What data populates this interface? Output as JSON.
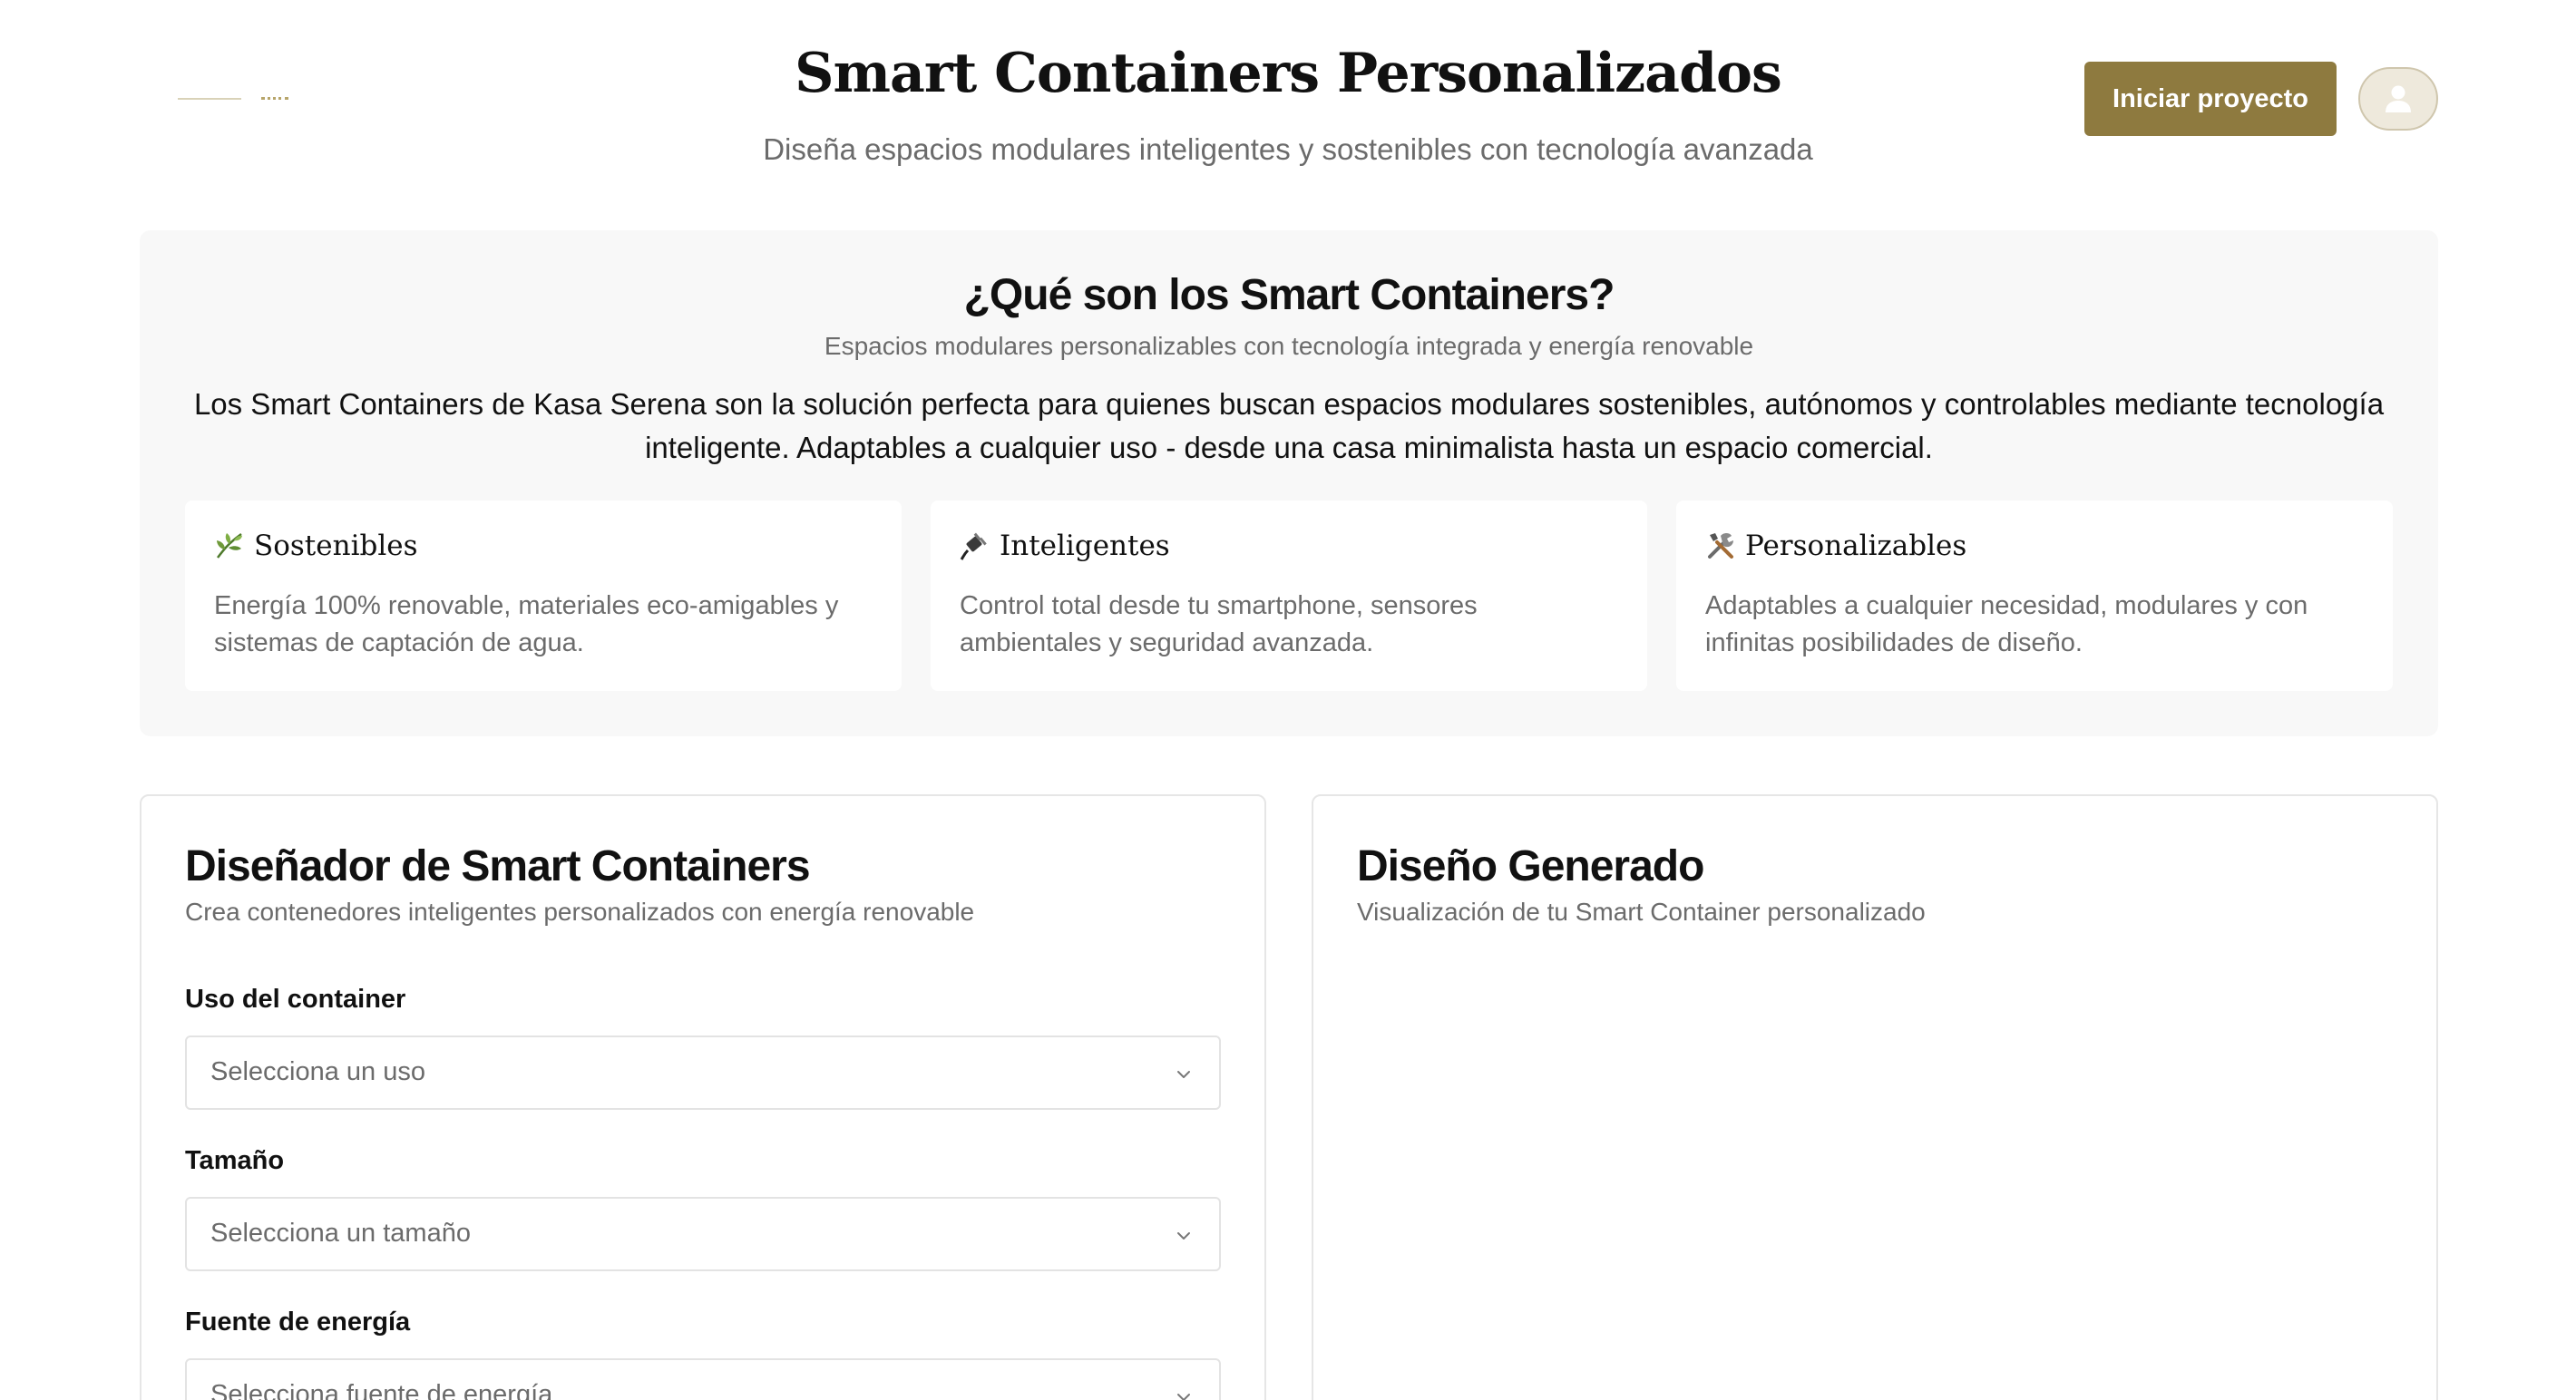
{
  "header": {
    "title": "Smart Containers Personalizados",
    "subtitle": "Diseña espacios modulares inteligentes y sostenibles con tecnología avanzada",
    "start_button": "Iniciar proyecto"
  },
  "intro": {
    "title": "¿Qué son los Smart Containers?",
    "subtitle": "Espacios modulares personalizables con tecnología integrada y energía renovable",
    "body": "Los Smart Containers de Kasa Serena son la solución perfecta para quienes buscan espacios modulares sostenibles, autónomos y controlables mediante tecnología inteligente. Adaptables a cualquier uso - desde una casa minimalista hasta un espacio comercial.",
    "features": [
      {
        "icon": "herb-icon",
        "title": "Sostenibles",
        "text": "Energía 100% renovable, materiales eco-amigables y sistemas de captación de agua."
      },
      {
        "icon": "plug-icon",
        "title": "Inteligentes",
        "text": "Control total desde tu smartphone, sensores ambientales y seguridad avanzada."
      },
      {
        "icon": "tools-icon",
        "title": "Personalizables",
        "text": "Adaptables a cualquier necesidad, modulares y con infinitas posibilidades de diseño."
      }
    ]
  },
  "designer": {
    "title": "Diseñador de Smart Containers",
    "subtitle": "Crea contenedores inteligentes personalizados con energía renovable",
    "fields": [
      {
        "label": "Uso del container",
        "placeholder": "Selecciona un uso"
      },
      {
        "label": "Tamaño",
        "placeholder": "Selecciona un tamaño"
      },
      {
        "label": "Fuente de energía",
        "placeholder": "Selecciona fuente de energía"
      }
    ]
  },
  "generated": {
    "title": "Diseño Generado",
    "subtitle": "Visualización de tu Smart Container personalizado"
  },
  "colors": {
    "accent": "#8e7a3f",
    "muted_text": "#6b6b6b",
    "section_bg": "#f8f8f8"
  }
}
